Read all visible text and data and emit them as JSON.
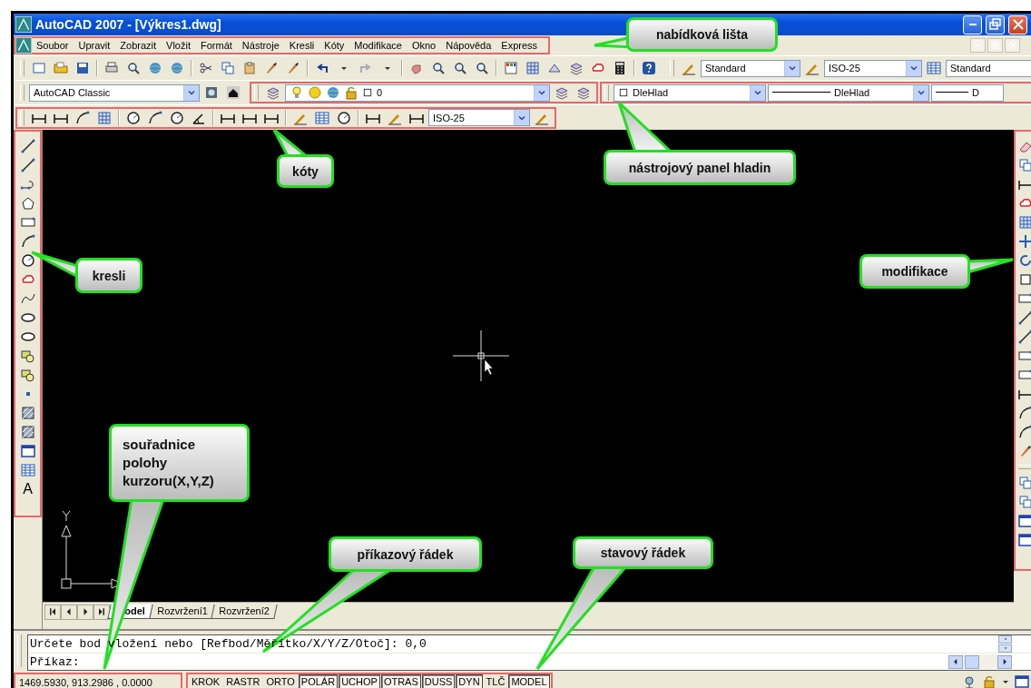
{
  "window": {
    "title": "AutoCAD 2007 - [Výkres1.dwg]"
  },
  "menu_bar": {
    "items": [
      "Soubor",
      "Upravit",
      "Zobrazit",
      "Vložit",
      "Formát",
      "Nástroje",
      "Kresli",
      "Kóty",
      "Modifikace",
      "Okno",
      "Nápověda",
      "Express"
    ]
  },
  "standard_toolbar": {
    "text_style": "Standard",
    "dimension_style": "ISO-25",
    "table_style": "Standard"
  },
  "workspace_toolbar": {
    "workspace": "AutoCAD Classic"
  },
  "layers_toolbar": {
    "layer": "0"
  },
  "properties_toolbar": {
    "color_name": "DleHlad",
    "linetype": "DleHlad",
    "lineweight": "D"
  },
  "dimension_toolbar": {
    "style": "ISO-25"
  },
  "draw_toolbar": {
    "text_tool": "A"
  },
  "layout_tabs": [
    {
      "label": "odel",
      "selected": true
    },
    {
      "label": "Rozvržení1",
      "selected": false
    },
    {
      "label": "Rozvržení2",
      "selected": false
    }
  ],
  "command_line": {
    "history": "Určete bod vložení nebo [Refbod/Měřítko/X/Y/Z/Otoč]: 0,0",
    "prompt": "Příkaz:"
  },
  "status_bar": {
    "coordinates": "1469.5930, 913.2986 , 0.0000",
    "toggles": [
      {
        "label": "KROK",
        "on": false
      },
      {
        "label": "RASTR",
        "on": false
      },
      {
        "label": "ORTO",
        "on": false
      },
      {
        "label": "POLÁR",
        "on": true
      },
      {
        "label": "UCHOP",
        "on": true
      },
      {
        "label": "OTRAS",
        "on": true
      },
      {
        "label": "DUSS",
        "on": true
      },
      {
        "label": "DYN",
        "on": true
      },
      {
        "label": "TLČ",
        "on": false
      },
      {
        "label": "MODEL",
        "on": true
      }
    ]
  },
  "callouts": [
    {
      "text": "nabídková lišta"
    },
    {
      "text": "kóty"
    },
    {
      "text": "nástrojový panel hladin"
    },
    {
      "text": "kresli"
    },
    {
      "text": "modifikace"
    },
    {
      "text": "souřadnice polohy kurzoru(X,Y,Z)"
    },
    {
      "text": "příkazový řádek"
    },
    {
      "text": "stavový řádek"
    }
  ]
}
